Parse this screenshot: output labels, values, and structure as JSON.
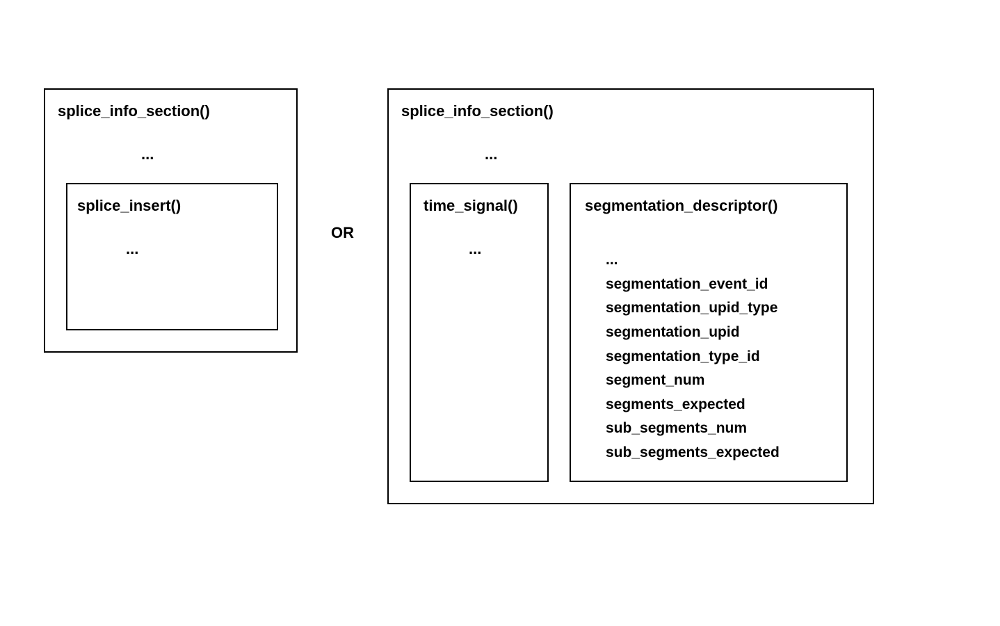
{
  "left": {
    "outer_title": "splice_info_section()",
    "outer_ellipsis": "...",
    "inner_title": "splice_insert()",
    "inner_ellipsis": "..."
  },
  "or_label": "OR",
  "right": {
    "outer_title": "splice_info_section()",
    "outer_ellipsis": "...",
    "time_signal": {
      "title": "time_signal()",
      "ellipsis": "..."
    },
    "segmentation": {
      "title": "segmentation_descriptor()",
      "fields": [
        "...",
        "segmentation_event_id",
        "segmentation_upid_type",
        "segmentation_upid",
        "segmentation_type_id",
        "segment_num",
        "segments_expected",
        "sub_segments_num",
        "sub_segments_expected"
      ]
    }
  }
}
